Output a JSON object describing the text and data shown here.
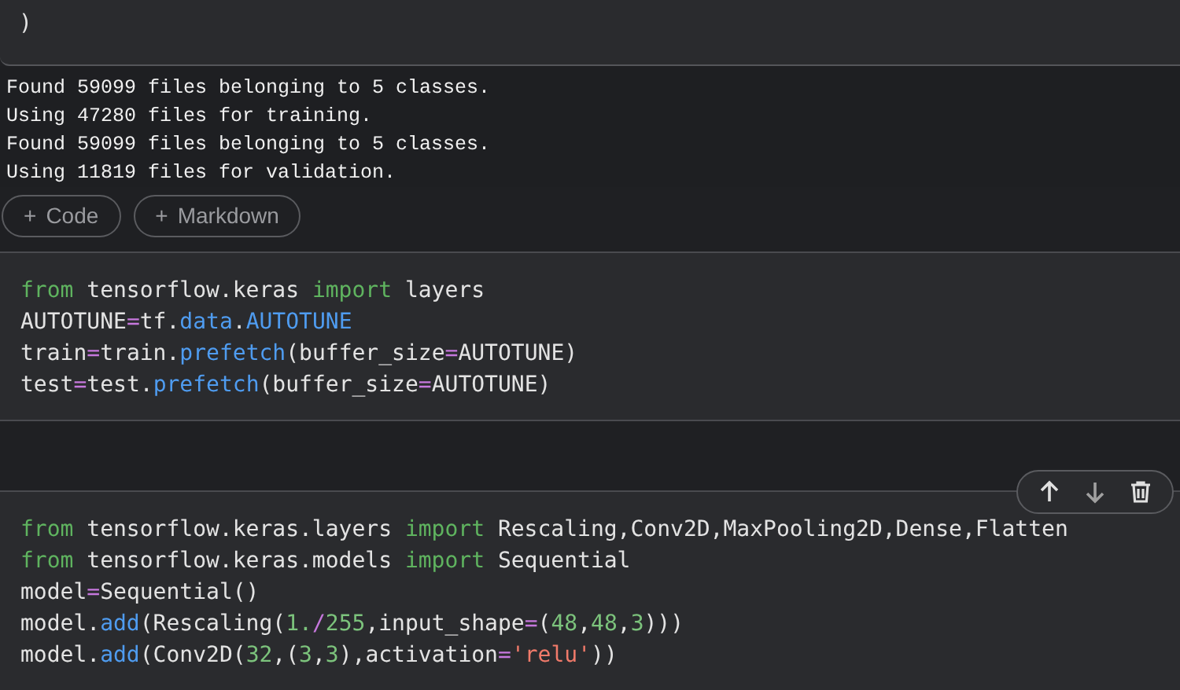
{
  "cells": [
    {
      "lines": [
        [
          {
            "kind": "plain",
            "text": ")"
          }
        ]
      ],
      "output": [
        "Found 59099 files belonging to 5 classes.",
        "Using 47280 files for training.",
        "Found 59099 files belonging to 5 classes.",
        "Using 11819 files for validation."
      ]
    },
    {
      "lines": [
        [
          {
            "kind": "keyword",
            "text": "from"
          },
          {
            "kind": "plain",
            "text": " tensorflow.keras "
          },
          {
            "kind": "keyword",
            "text": "import"
          },
          {
            "kind": "plain",
            "text": " layers"
          }
        ],
        [
          {
            "kind": "plain",
            "text": "AUTOTUNE"
          },
          {
            "kind": "op",
            "text": "="
          },
          {
            "kind": "plain",
            "text": "tf."
          },
          {
            "kind": "attr",
            "text": "data"
          },
          {
            "kind": "plain",
            "text": "."
          },
          {
            "kind": "attr",
            "text": "AUTOTUNE"
          }
        ],
        [
          {
            "kind": "plain",
            "text": "train"
          },
          {
            "kind": "op",
            "text": "="
          },
          {
            "kind": "plain",
            "text": "train."
          },
          {
            "kind": "attr",
            "text": "prefetch"
          },
          {
            "kind": "plain",
            "text": "(buffer_size"
          },
          {
            "kind": "op",
            "text": "="
          },
          {
            "kind": "plain",
            "text": "AUTOTUNE)"
          }
        ],
        [
          {
            "kind": "plain",
            "text": "test"
          },
          {
            "kind": "op",
            "text": "="
          },
          {
            "kind": "plain",
            "text": "test."
          },
          {
            "kind": "attr",
            "text": "prefetch"
          },
          {
            "kind": "plain",
            "text": "(buffer_size"
          },
          {
            "kind": "op",
            "text": "="
          },
          {
            "kind": "plain",
            "text": "AUTOTUNE)"
          }
        ]
      ]
    },
    {
      "toolbar": true,
      "lines": [
        [
          {
            "kind": "keyword",
            "text": "from"
          },
          {
            "kind": "plain",
            "text": " tensorflow.keras.layers "
          },
          {
            "kind": "keyword",
            "text": "import"
          },
          {
            "kind": "plain",
            "text": " Rescaling,Conv2D,MaxPooling2D,Dense,Flatten"
          }
        ],
        [
          {
            "kind": "keyword",
            "text": "from"
          },
          {
            "kind": "plain",
            "text": " tensorflow.keras.models "
          },
          {
            "kind": "keyword",
            "text": "import"
          },
          {
            "kind": "plain",
            "text": " Sequential"
          }
        ],
        [
          {
            "kind": "plain",
            "text": "model"
          },
          {
            "kind": "op",
            "text": "="
          },
          {
            "kind": "plain",
            "text": "Sequential()"
          }
        ],
        [
          {
            "kind": "plain",
            "text": "model."
          },
          {
            "kind": "attr",
            "text": "add"
          },
          {
            "kind": "plain",
            "text": "(Rescaling("
          },
          {
            "kind": "number",
            "text": "1."
          },
          {
            "kind": "op",
            "text": "/"
          },
          {
            "kind": "number",
            "text": "255"
          },
          {
            "kind": "plain",
            "text": ",input_shape"
          },
          {
            "kind": "op",
            "text": "="
          },
          {
            "kind": "plain",
            "text": "("
          },
          {
            "kind": "number",
            "text": "48"
          },
          {
            "kind": "plain",
            "text": ","
          },
          {
            "kind": "number",
            "text": "48"
          },
          {
            "kind": "plain",
            "text": ","
          },
          {
            "kind": "number",
            "text": "3"
          },
          {
            "kind": "plain",
            "text": ")))"
          }
        ],
        [
          {
            "kind": "plain",
            "text": "model."
          },
          {
            "kind": "attr",
            "text": "add"
          },
          {
            "kind": "plain",
            "text": "(Conv2D("
          },
          {
            "kind": "number",
            "text": "32"
          },
          {
            "kind": "plain",
            "text": ",("
          },
          {
            "kind": "number",
            "text": "3"
          },
          {
            "kind": "plain",
            "text": ","
          },
          {
            "kind": "number",
            "text": "3"
          },
          {
            "kind": "plain",
            "text": "),activation"
          },
          {
            "kind": "op",
            "text": "="
          },
          {
            "kind": "string",
            "text": "'relu'"
          },
          {
            "kind": "plain",
            "text": "))"
          }
        ]
      ]
    }
  ],
  "add_buttons": [
    {
      "icon": "+",
      "label": "Code"
    },
    {
      "icon": "+",
      "label": "Markdown"
    }
  ]
}
